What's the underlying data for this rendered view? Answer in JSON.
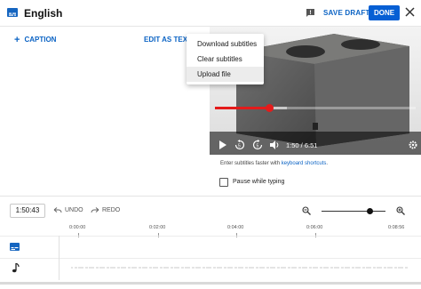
{
  "header": {
    "title": "English",
    "save_draft": "SAVE DRAFT",
    "done": "DONE"
  },
  "captions": {
    "add_caption": "CAPTION",
    "edit_as_text": "EDIT AS TEXT"
  },
  "menu": {
    "items": [
      "Download subtitles",
      "Clear subtitles",
      "Upload file"
    ],
    "highlighted": "Upload file"
  },
  "player": {
    "current_time": "1:50",
    "duration": "6:51",
    "time_text": "1:50 / 6:51",
    "played_fraction": 0.268,
    "buffered_fraction": 0.36
  },
  "info": {
    "text_before": "Enter subtitles faster with ",
    "link": "keyboard shortcuts",
    "text_after": "."
  },
  "pause_option": {
    "label": "Pause while typing",
    "checked": false
  },
  "timeline": {
    "time_input": "1:50:43",
    "undo": "UNDO",
    "redo": "REDO",
    "zoom_level": 0.75,
    "ticks": [
      "0:00:00",
      "0:02:00",
      "0:04:00",
      "0:06:00",
      "0:08:56"
    ]
  },
  "colors": {
    "accent_blue": "#065fd4",
    "progress_red": "#e41b1b"
  },
  "icons": {
    "subtitles": "subtitles-icon",
    "feedback": "feedback-icon",
    "close": "close-icon",
    "add": "plus-icon",
    "play": "play-icon",
    "rewind": "rewind-5-icon",
    "forward": "forward-5-icon",
    "volume": "volume-icon",
    "settings": "gear-icon",
    "undo": "undo-icon",
    "redo": "redo-icon",
    "zoom_out": "zoom-out-icon",
    "zoom_in": "zoom-in-icon",
    "audio": "music-note-icon"
  }
}
